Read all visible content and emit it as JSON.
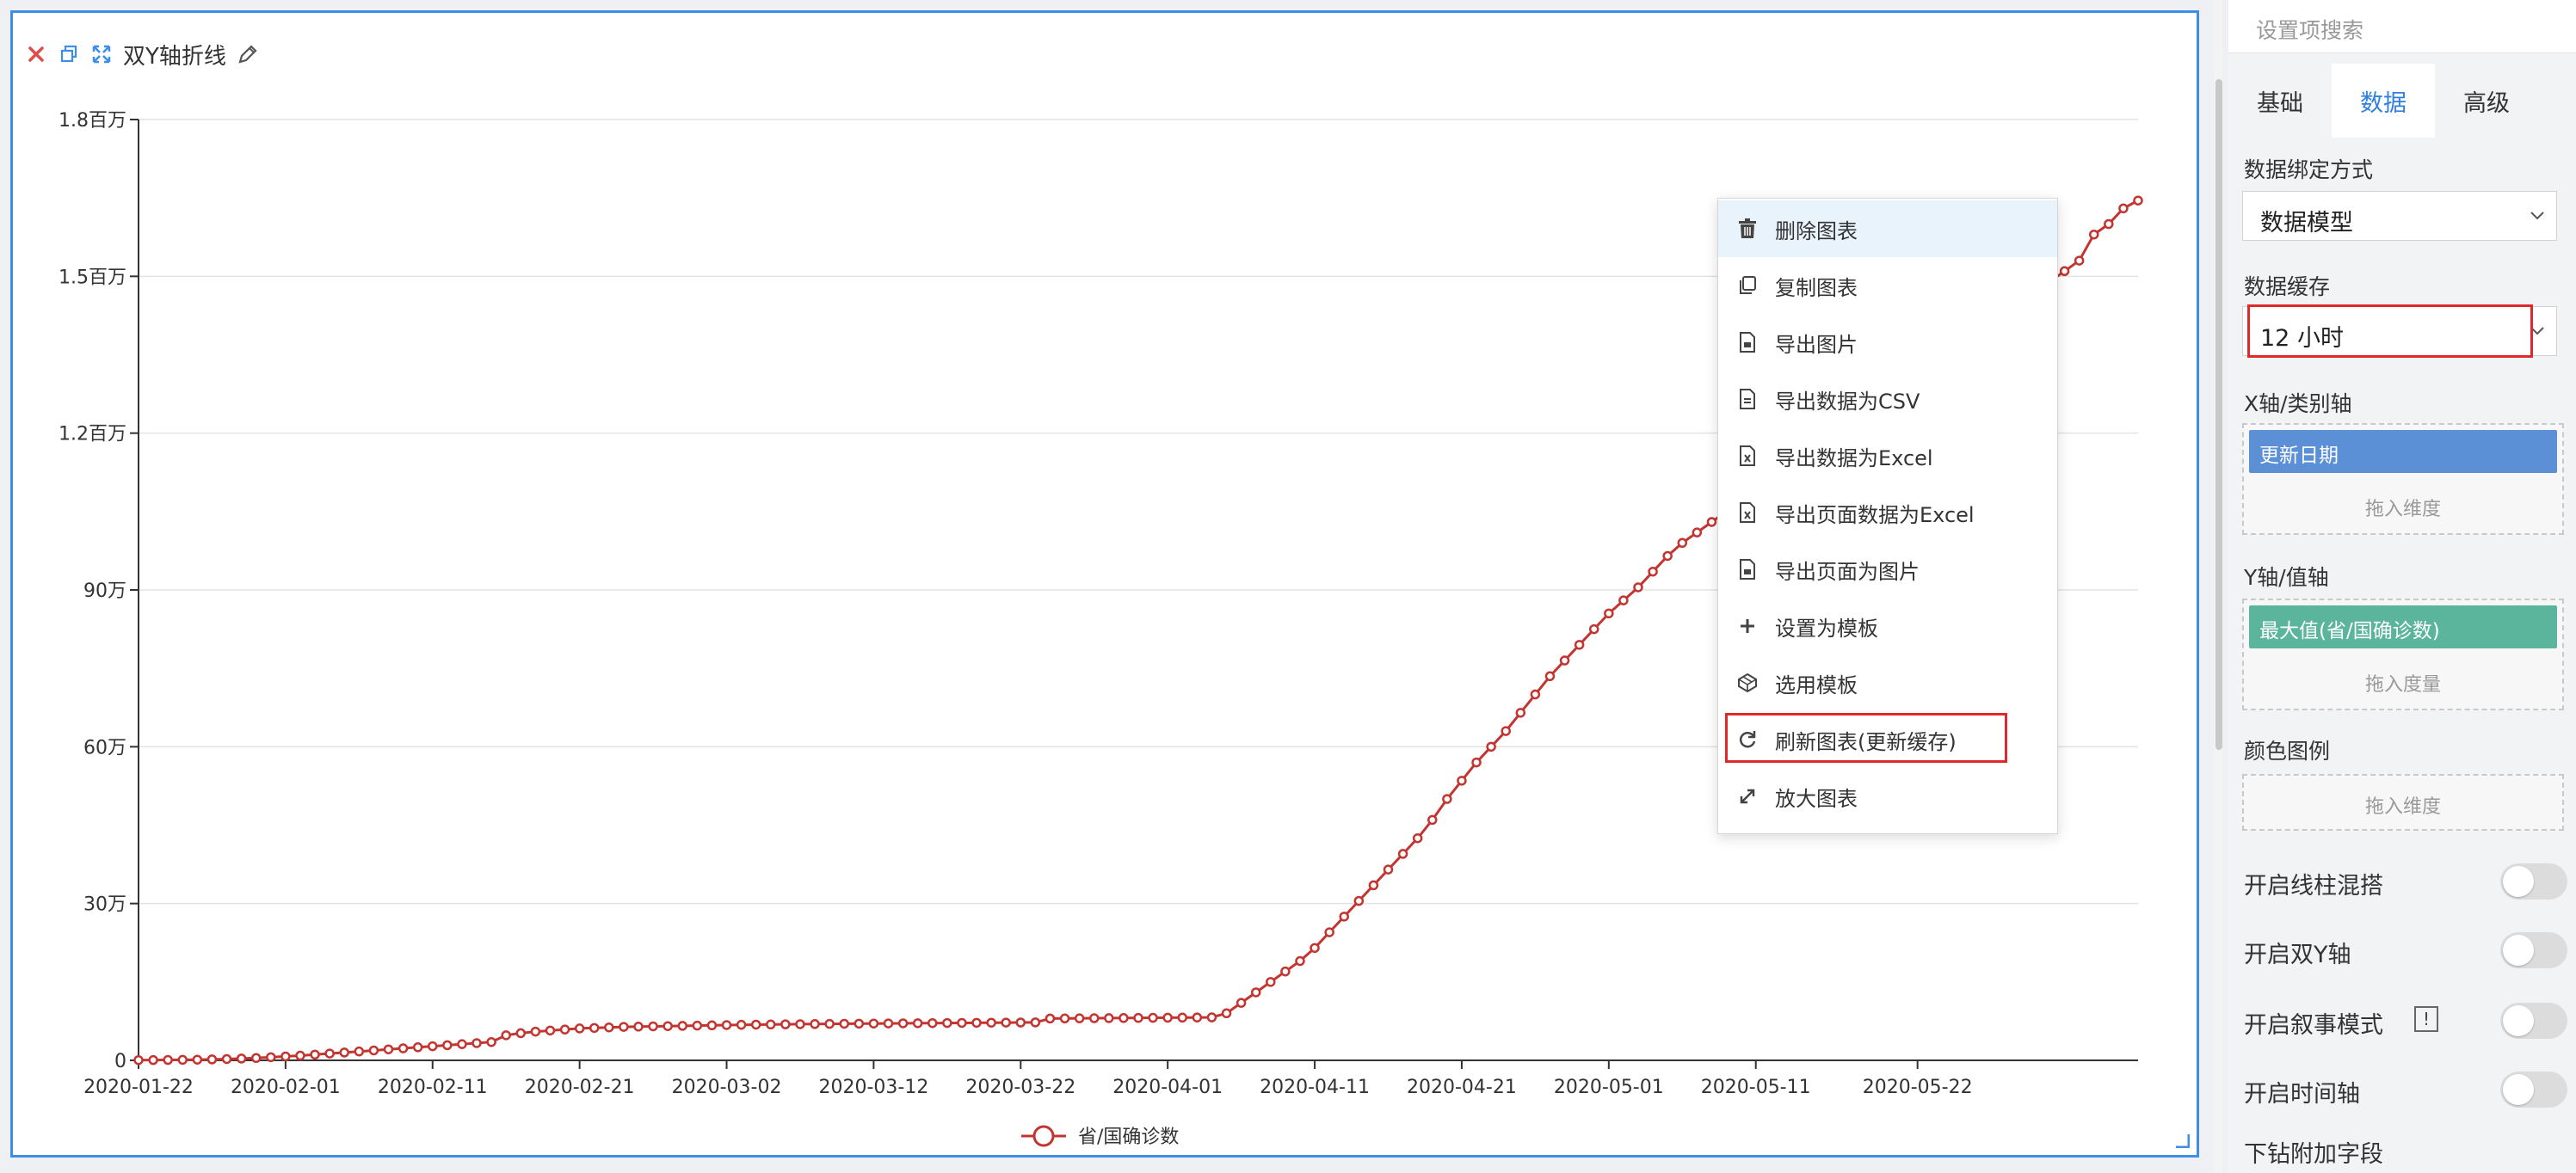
{
  "widget": {
    "title": "双Y轴折线",
    "icons": [
      "close-icon",
      "copy-icon",
      "expand-icon",
      "edit-icon"
    ]
  },
  "chart_data": {
    "type": "line",
    "title": "",
    "xlabel": "",
    "ylabel": "",
    "ylim": [
      0,
      1800000
    ],
    "yticks": [
      {
        "value": 0,
        "label": "0"
      },
      {
        "value": 300000,
        "label": "30万"
      },
      {
        "value": 600000,
        "label": "60万"
      },
      {
        "value": 900000,
        "label": "90万"
      },
      {
        "value": 1200000,
        "label": "1.2百万"
      },
      {
        "value": 1500000,
        "label": "1.5百万"
      },
      {
        "value": 1800000,
        "label": "1.8百万"
      }
    ],
    "xticks": [
      "2020-01-22",
      "2020-02-01",
      "2020-02-11",
      "2020-02-21",
      "2020-03-02",
      "2020-03-12",
      "2020-03-22",
      "2020-04-01",
      "2020-04-11",
      "2020-04-21",
      "2020-05-01",
      "2020-05-11",
      "2020-05-22"
    ],
    "x_start": "2020-01-22",
    "grid": true,
    "legend_position": "bottom-center",
    "color": "#c23531",
    "series": [
      {
        "name": "省/国确诊数",
        "values": [
          500,
          600,
          800,
          1000,
          1300,
          1800,
          2500,
          3500,
          4500,
          6000,
          7500,
          9000,
          11000,
          13000,
          15000,
          17000,
          19000,
          21000,
          23000,
          25000,
          27000,
          29000,
          31000,
          33000,
          35000,
          48000,
          52000,
          55000,
          57000,
          59000,
          61000,
          62000,
          63000,
          64000,
          64500,
          65000,
          65500,
          66000,
          66500,
          67000,
          67500,
          68000,
          68300,
          68600,
          68900,
          69200,
          69500,
          69800,
          70000,
          70200,
          70400,
          70600,
          70800,
          71000,
          71200,
          71400,
          71600,
          71800,
          72000,
          72200,
          72400,
          72600,
          80000,
          80200,
          80400,
          80600,
          80800,
          81000,
          81200,
          81400,
          81600,
          81800,
          82000,
          82200,
          90000,
          110000,
          130000,
          150000,
          170000,
          190000,
          215000,
          245000,
          275000,
          305000,
          335000,
          365000,
          395000,
          425000,
          460000,
          500000,
          535000,
          570000,
          600000,
          630000,
          665000,
          700000,
          735000,
          765000,
          795000,
          825000,
          855000,
          880000,
          905000,
          935000,
          965000,
          990000,
          1010000,
          1030000,
          1050000,
          1070000,
          1090000,
          1110000,
          1130000,
          1150000,
          1170000,
          1190000,
          1210000,
          1230000,
          1250000,
          1270000,
          1290000,
          1310000,
          1330000,
          1350000,
          1370000,
          1390000,
          1410000,
          1430000,
          1450000,
          1470000,
          1490000,
          1510000,
          1530000,
          1580000,
          1600000,
          1630000,
          1645000
        ]
      }
    ]
  },
  "context_menu": {
    "items": [
      {
        "label": "删除图表",
        "icon": "trash-icon"
      },
      {
        "label": "复制图表",
        "icon": "copy-icon"
      },
      {
        "label": "导出图片",
        "icon": "image-file-icon"
      },
      {
        "label": "导出数据为CSV",
        "icon": "csv-file-icon"
      },
      {
        "label": "导出数据为Excel",
        "icon": "excel-file-icon"
      },
      {
        "label": "导出页面数据为Excel",
        "icon": "excel-file-icon"
      },
      {
        "label": "导出页面为图片",
        "icon": "image-file-icon"
      },
      {
        "label": "设置为模板",
        "icon": "plus-icon"
      },
      {
        "label": "选用模板",
        "icon": "template-icon"
      },
      {
        "label": "刷新图表(更新缓存)",
        "icon": "refresh-icon"
      },
      {
        "label": "放大图表",
        "icon": "enlarge-icon"
      }
    ]
  },
  "panel": {
    "search_placeholder": "设置项搜索",
    "tabs": [
      {
        "label": "基础"
      },
      {
        "label": "数据"
      },
      {
        "label": "高级"
      }
    ],
    "binding_label": "数据绑定方式",
    "binding_value": "数据模型",
    "cache_label": "数据缓存",
    "cache_value": "12 小时",
    "x_axis_label": "X轴/类别轴",
    "x_axis_field": "更新日期",
    "x_axis_hint": "拖入维度",
    "y_axis_label": "Y轴/值轴",
    "y_axis_field": "最大值(省/国确诊数)",
    "y_axis_hint": "拖入度量",
    "color_legend_label": "颜色图例",
    "color_legend_hint": "拖入维度",
    "toggles": [
      {
        "label": "开启线柱混搭",
        "on": false
      },
      {
        "label": "开启双Y轴",
        "on": false
      },
      {
        "label": "开启叙事模式",
        "on": false
      },
      {
        "label": "开启时间轴",
        "on": false
      }
    ],
    "drill_label": "下钻附加字段",
    "colors": {
      "x_pill": "#5b8fd6",
      "y_pill": "#5bb59c",
      "accent": "#2f7fe0"
    }
  }
}
